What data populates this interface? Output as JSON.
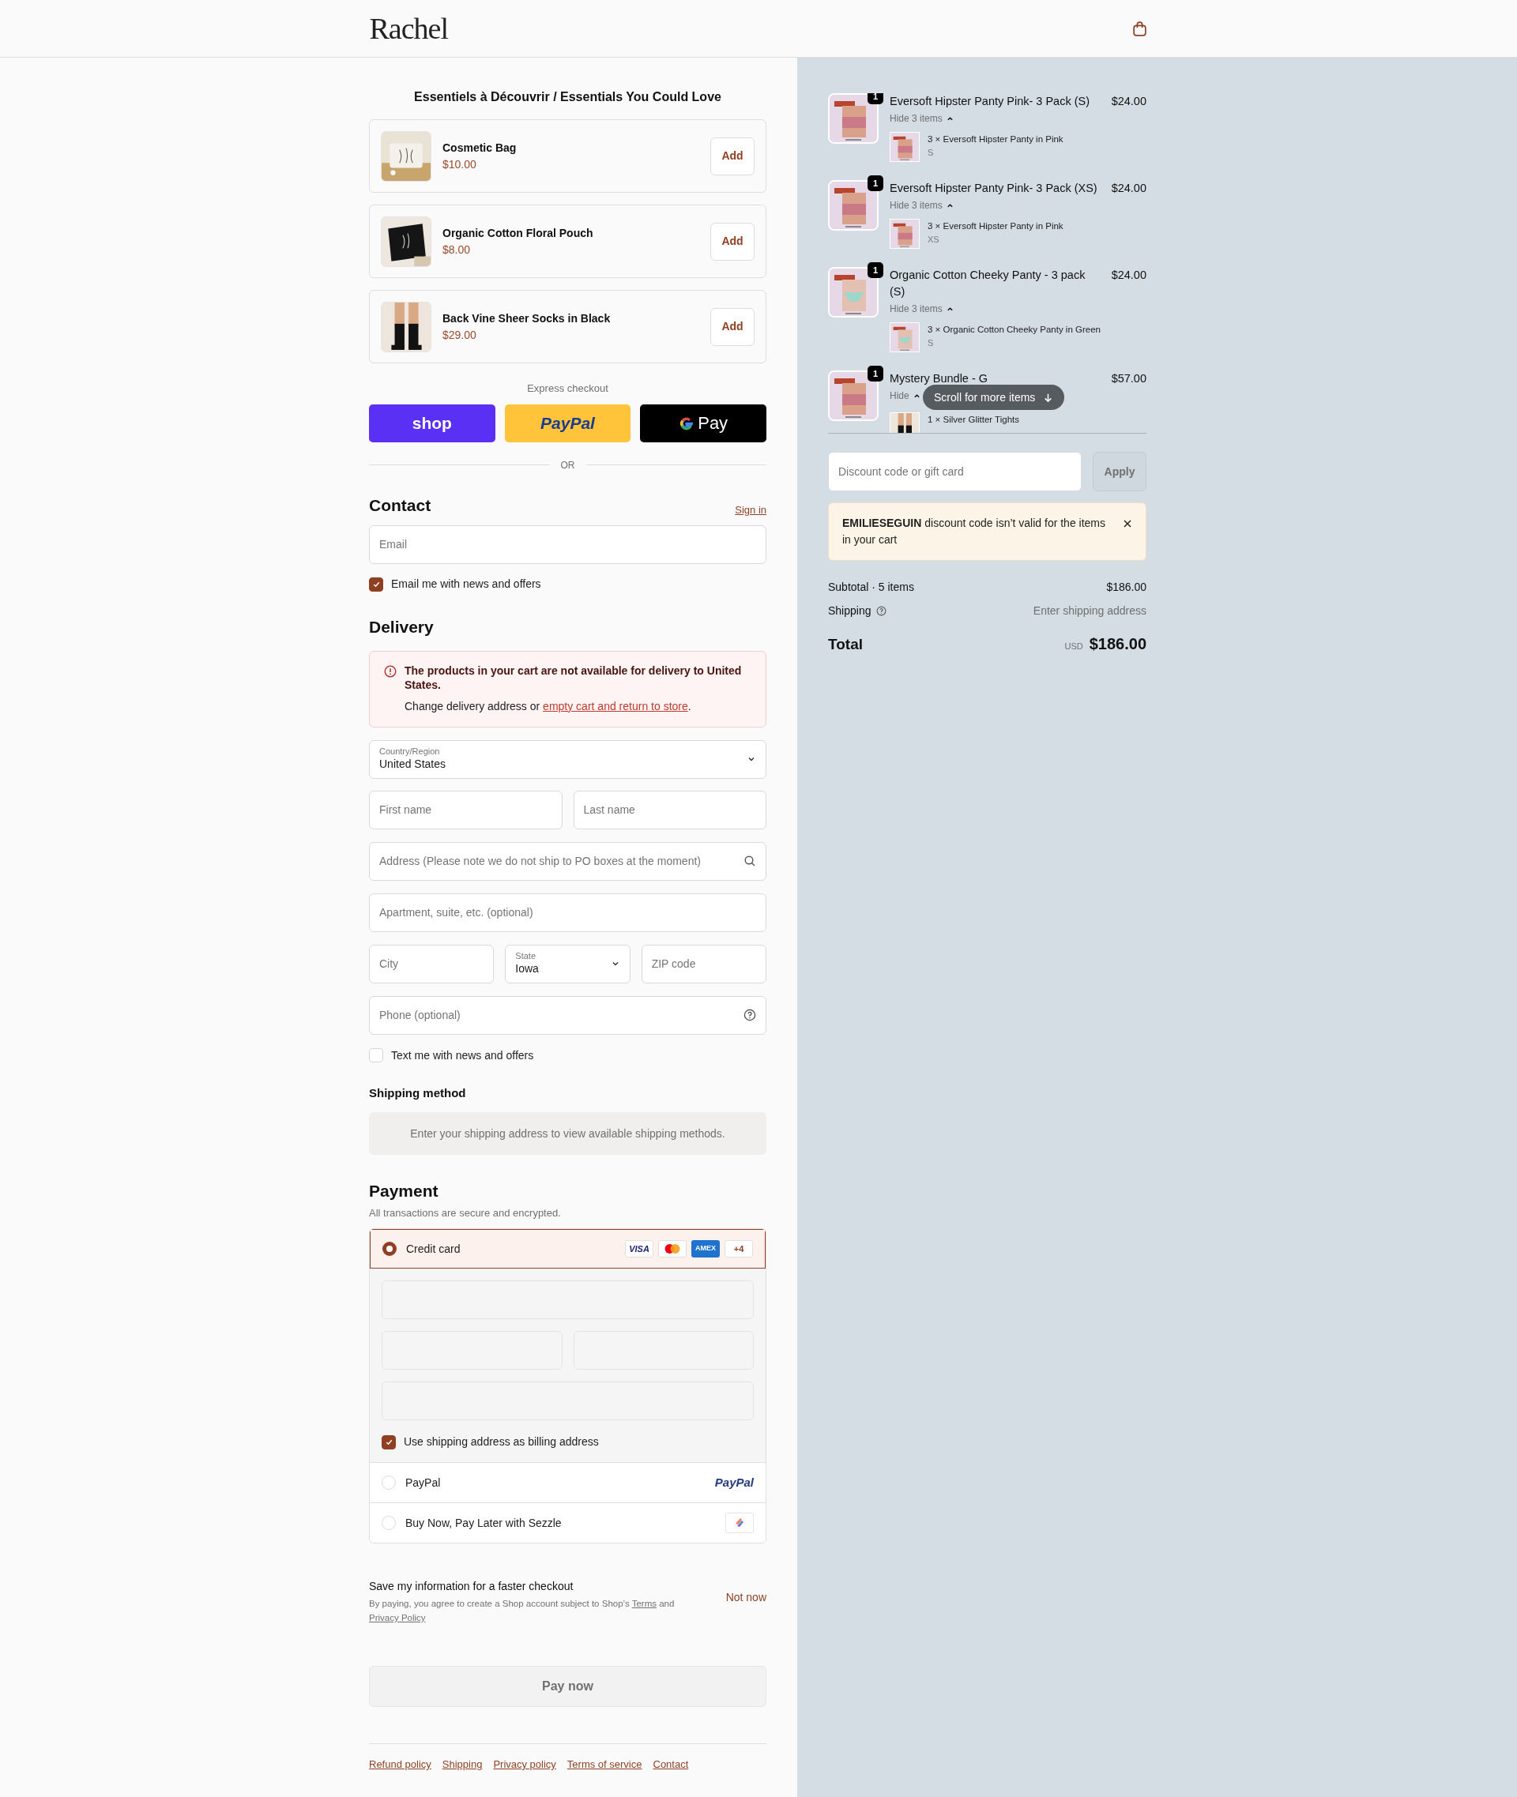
{
  "header": {
    "logo": "Rachel"
  },
  "upsell": {
    "title": "Essentiels à Découvrir / Essentials You Could Love",
    "products": [
      {
        "name": "Cosmetic Bag",
        "price": "$10.00",
        "button": "Add"
      },
      {
        "name": "Organic Cotton Floral Pouch",
        "price": "$8.00",
        "button": "Add"
      },
      {
        "name": "Back Vine Sheer Socks in Black",
        "price": "$29.00",
        "button": "Add"
      }
    ]
  },
  "express": {
    "label": "Express checkout",
    "buttons": [
      {
        "kind": "shop",
        "label": "shop"
      },
      {
        "kind": "paypal",
        "label": "PayPal"
      },
      {
        "kind": "gpay",
        "label": "Pay"
      }
    ],
    "divider": "OR"
  },
  "contact": {
    "title": "Contact",
    "sign_in": "Sign in",
    "email_placeholder": "Email",
    "newsletter": {
      "label": "Email me with news and offers",
      "checked": true
    }
  },
  "delivery": {
    "title": "Delivery",
    "error": {
      "title": "The products in your cart are not available for delivery to United States.",
      "text_before": "Change delivery address or ",
      "link": "empty cart and return to store",
      "text_after": "."
    },
    "country": {
      "label": "Country/Region",
      "value": "United States"
    },
    "first_name": "First name",
    "last_name": "Last name",
    "address": "Address (Please note we do not ship to PO boxes at the moment)",
    "apartment": "Apartment, suite, etc. (optional)",
    "city": "City",
    "state": {
      "label": "State",
      "value": "Iowa"
    },
    "zip": "ZIP code",
    "phone": "Phone (optional)",
    "sms": {
      "label": "Text me with news and offers",
      "checked": false
    }
  },
  "shipping_method": {
    "title": "Shipping method",
    "message": "Enter your shipping address to view available shipping methods."
  },
  "payment": {
    "title": "Payment",
    "subtitle": "All transactions are secure and encrypted.",
    "methods": [
      {
        "kind": "card",
        "label": "Credit card",
        "selected": true,
        "brands": [
          "VISA",
          "AMEX"
        ],
        "more": "+4"
      },
      {
        "kind": "paypal",
        "label": "PayPal",
        "selected": false,
        "logo": "PayPal"
      },
      {
        "kind": "sezzle",
        "label": "Buy Now, Pay Later with Sezzle",
        "selected": false
      }
    ],
    "billing": {
      "label": "Use shipping address as billing address",
      "checked": true
    }
  },
  "save_info": {
    "title": "Save my information for a faster checkout",
    "text": "By paying, you agree to create a Shop account subject to Shop’s ",
    "terms": "Terms",
    "and": " and",
    "privacy": "Privacy Policy",
    "dismiss": "Not now"
  },
  "pay_button": "Pay now",
  "footer_links": [
    "Refund policy",
    "Shipping",
    "Privacy policy",
    "Terms of service",
    "Contact"
  ],
  "summary": {
    "items": [
      {
        "name": "Eversoft Hipster Panty Pink- 3 Pack (S)",
        "price": "$24.00",
        "quantity": "1",
        "toggle": "Hide 3 items",
        "expanded": true,
        "contents": [
          {
            "text": "3 × Eversoft Hipster Panty in Pink",
            "variant": "S"
          }
        ]
      },
      {
        "name": "Eversoft Hipster Panty Pink- 3 Pack (XS)",
        "price": "$24.00",
        "quantity": "1",
        "toggle": "Hide 3 items",
        "expanded": true,
        "contents": [
          {
            "text": "3 × Eversoft Hipster Panty in Pink",
            "variant": "XS"
          }
        ]
      },
      {
        "name": "Organic Cotton Cheeky Panty - 3 pack (S)",
        "price": "$24.00",
        "quantity": "1",
        "toggle": "Hide 3 items",
        "expanded": true,
        "contents": [
          {
            "text": "3 × Organic Cotton Cheeky Panty in Green",
            "variant": "S"
          }
        ]
      },
      {
        "name": "Mystery Bundle - G",
        "price": "$57.00",
        "quantity": "1",
        "toggle": "Hide",
        "expanded": true,
        "contents": [
          {
            "text": "1 × Silver Glitter Tights"
          }
        ]
      }
    ],
    "scroll_hint": "Scroll for more items",
    "discount": {
      "placeholder": "Discount code or gift card",
      "button": "Apply"
    },
    "alert": {
      "code": "EMILIESEGUIN",
      "message": " discount code isn’t valid for the items in your cart"
    },
    "subtotal_label": "Subtotal · 5 items",
    "subtotal": "$186.00",
    "shipping_label": "Shipping",
    "shipping_value": "Enter shipping address",
    "total_label": "Total",
    "currency": "USD",
    "total": "$186.00"
  }
}
